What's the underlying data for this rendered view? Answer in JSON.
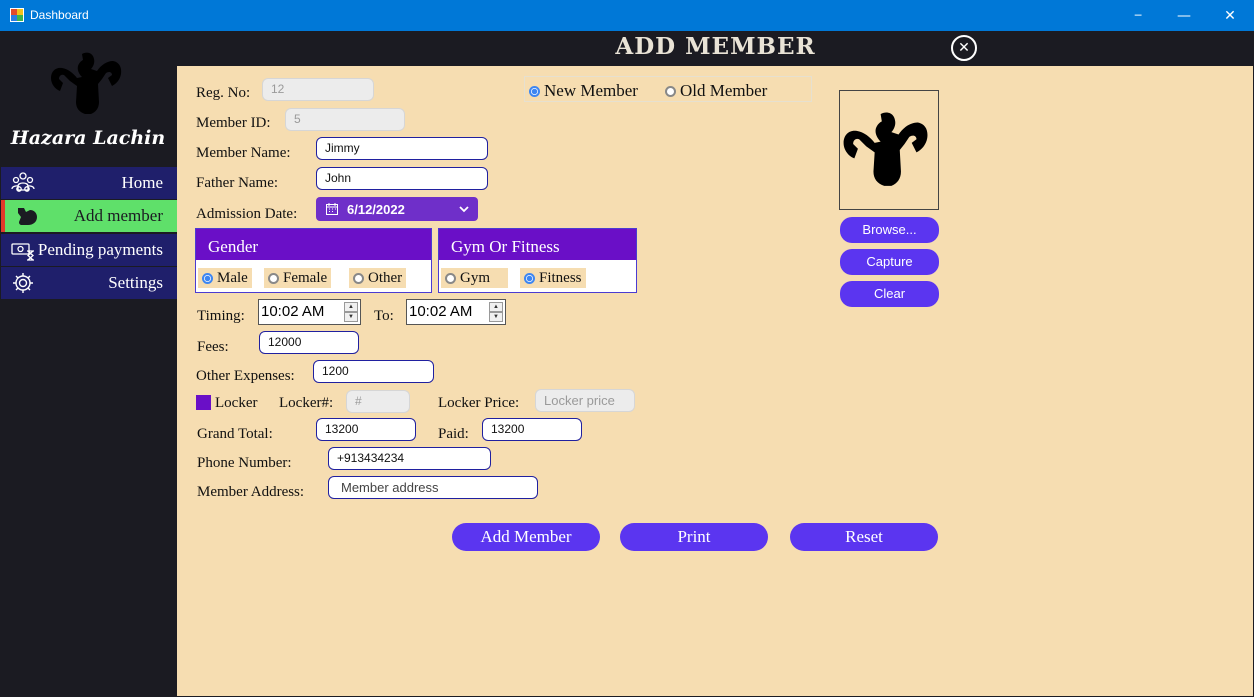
{
  "window": {
    "title": "Dashboard"
  },
  "sidebar": {
    "brand": "Hazara Lachin",
    "items": [
      {
        "label": "Home"
      },
      {
        "label": "Add member"
      },
      {
        "label": "Pending payments"
      },
      {
        "label": "Settings"
      }
    ]
  },
  "header": {
    "title": "ADD MEMBER"
  },
  "member_type": {
    "new_label": "New Member",
    "old_label": "Old Member",
    "selected": "New Member"
  },
  "form": {
    "reg_no_label": "Reg. No:",
    "reg_no": "12",
    "member_id_label": "Member ID:",
    "member_id": "5",
    "member_name_label": "Member Name:",
    "member_name": "Jimmy",
    "father_name_label": "Father Name:",
    "father_name": "John",
    "admission_date_label": "Admission Date:",
    "admission_date": "6/12/2022",
    "gender": {
      "title": "Gender",
      "options": [
        "Male",
        "Female",
        "Other"
      ],
      "selected": "Male"
    },
    "gym_fitness": {
      "title": "Gym Or Fitness",
      "options": [
        "Gym",
        "Fitness"
      ],
      "selected": "Fitness"
    },
    "timing_label": "Timing:",
    "timing_from": "10:02 AM",
    "to_label": "To:",
    "timing_to": "10:02 AM",
    "fees_label": "Fees:",
    "fees": "12000",
    "other_expenses_label": "Other Expenses:",
    "other_expenses": "1200",
    "locker_label": "Locker",
    "locker_no_label": "Locker#:",
    "locker_no_placeholder": "#",
    "locker_price_label": "Locker Price:",
    "locker_price_placeholder": "Locker price",
    "grand_total_label": "Grand Total:",
    "grand_total": "13200",
    "paid_label": "Paid:",
    "paid": "13200",
    "phone_label": "Phone Number:",
    "phone": "+913434234",
    "address_label": "Member Address:",
    "address_placeholder": "Member address"
  },
  "photo": {
    "browse_label": "Browse...",
    "capture_label": "Capture",
    "clear_label": "Clear"
  },
  "actions": {
    "add_label": "Add Member",
    "print_label": "Print",
    "reset_label": "Reset"
  },
  "colors": {
    "accent": "#5b35f0",
    "panel_head": "#6a0fc7",
    "background": "#f6ddb1",
    "sidebar": "#1b1b22",
    "nav": "#1f1f6b",
    "nav_active": "#5fe06a"
  }
}
